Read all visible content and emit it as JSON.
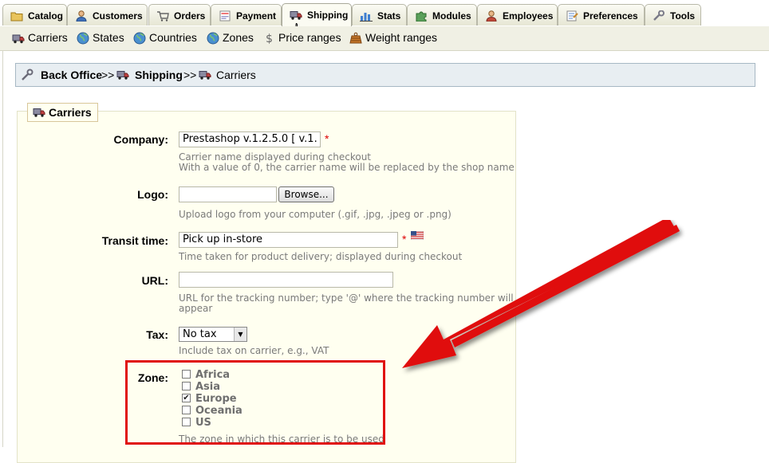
{
  "tabs": [
    {
      "label": "Catalog",
      "icon": "folder-icon"
    },
    {
      "label": "Customers",
      "icon": "user-icon"
    },
    {
      "label": "Orders",
      "icon": "cart-icon"
    },
    {
      "label": "Payment",
      "icon": "payment-icon"
    },
    {
      "label": "Shipping",
      "icon": "truck-icon",
      "active": true
    },
    {
      "label": "Stats",
      "icon": "chart-icon"
    },
    {
      "label": "Modules",
      "icon": "puzzle-icon"
    },
    {
      "label": "Employees",
      "icon": "employee-icon"
    },
    {
      "label": "Preferences",
      "icon": "preferences-icon"
    },
    {
      "label": "Tools",
      "icon": "wrench-icon"
    }
  ],
  "submenu": [
    {
      "label": "Carriers",
      "icon": "truck-icon"
    },
    {
      "label": "States",
      "icon": "globe-icon"
    },
    {
      "label": "Countries",
      "icon": "globe-icon"
    },
    {
      "label": "Zones",
      "icon": "globe-icon"
    },
    {
      "label": "Price ranges",
      "icon": "dollar-icon"
    },
    {
      "label": "Weight ranges",
      "icon": "weight-icon"
    }
  ],
  "breadcrumb": {
    "root": "Back Office",
    "sep1": ">>",
    "section": "Shipping",
    "sep2": ">>",
    "current": "Carriers"
  },
  "form": {
    "legend": "Carriers",
    "company": {
      "label": "Company:",
      "value": "Prestashop v.1.2.5.0 [ v.1.",
      "hint1": "Carrier name displayed during checkout",
      "hint2": "With a value of 0, the carrier name will be replaced by the shop name"
    },
    "logo": {
      "label": "Logo:",
      "value": "",
      "browse_label": "Browse...",
      "hint": "Upload logo from your computer (.gif, .jpg, .jpeg or .png)"
    },
    "transit": {
      "label": "Transit time:",
      "value": "Pick up in-store",
      "hint": "Time taken for product delivery; displayed during checkout"
    },
    "url": {
      "label": "URL:",
      "value": "",
      "hint1": "URL for the tracking number; type '@' where the tracking number will",
      "hint2": "appear"
    },
    "tax": {
      "label": "Tax:",
      "selected": "No tax",
      "hint": "Include tax on carrier, e.g., VAT"
    },
    "zone": {
      "label": "Zone:",
      "options": [
        {
          "label": "Africa",
          "checked": false
        },
        {
          "label": "Asia",
          "checked": false
        },
        {
          "label": "Europe",
          "checked": true
        },
        {
          "label": "Oceania",
          "checked": false
        },
        {
          "label": "US",
          "checked": false
        }
      ],
      "hint": "The zone in which this carrier is to be used"
    },
    "required_mark": "*"
  },
  "annotation_color": "#e01010"
}
